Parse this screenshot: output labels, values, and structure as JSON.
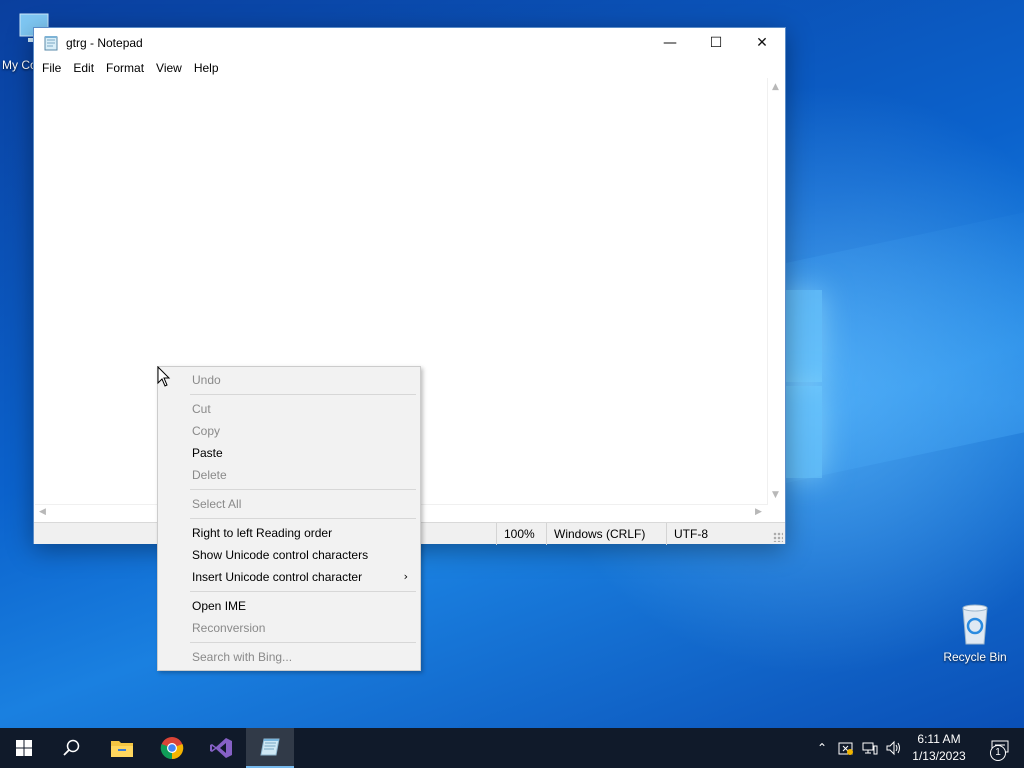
{
  "desktop": {
    "icons": [
      {
        "label": "My Co",
        "icon": "this-pc-icon"
      },
      {
        "label": "Recycle Bin",
        "icon": "recycle-bin-icon"
      }
    ]
  },
  "notepad": {
    "title": "gtrg - Notepad",
    "caption": {
      "minimize": "—",
      "maximize": "☐",
      "close": "✕"
    },
    "menu": [
      "File",
      "Edit",
      "Format",
      "View",
      "Help"
    ],
    "content": "",
    "status": {
      "zoom": "100%",
      "line_ending": "Windows (CRLF)",
      "encoding": "UTF-8"
    }
  },
  "context_menu": {
    "groups": [
      [
        {
          "label": "Undo",
          "enabled": false
        }
      ],
      [
        {
          "label": "Cut",
          "enabled": false
        },
        {
          "label": "Copy",
          "enabled": false
        },
        {
          "label": "Paste",
          "enabled": true
        },
        {
          "label": "Delete",
          "enabled": false
        }
      ],
      [
        {
          "label": "Select All",
          "enabled": false
        }
      ],
      [
        {
          "label": "Right to left Reading order",
          "enabled": true
        },
        {
          "label": "Show Unicode control characters",
          "enabled": true
        },
        {
          "label": "Insert Unicode control character",
          "enabled": true,
          "submenu": true
        }
      ],
      [
        {
          "label": "Open IME",
          "enabled": true
        },
        {
          "label": "Reconversion",
          "enabled": false
        }
      ],
      [
        {
          "label": "Search with Bing...",
          "enabled": false
        }
      ]
    ]
  },
  "taskbar": {
    "apps": [
      "start-icon",
      "search-icon",
      "file-explorer-icon",
      "chrome-icon",
      "visual-studio-icon",
      "notepad-icon"
    ],
    "active_app": "notepad-icon",
    "clock": {
      "time": "6:11 AM",
      "date": "1/13/2023"
    },
    "notification_count": "1"
  },
  "colors": {
    "accent": "#0078d7",
    "taskbar": "#101a2a",
    "disabled_text": "#8a8a8a"
  }
}
